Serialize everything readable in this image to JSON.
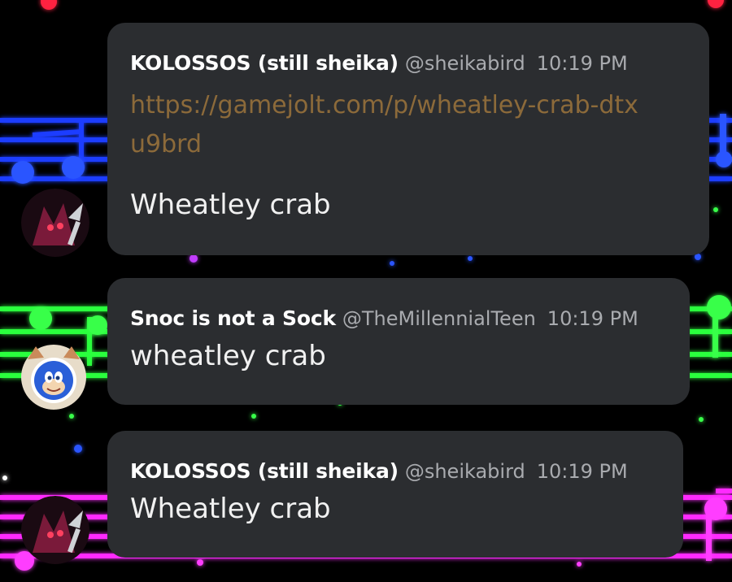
{
  "messages": [
    {
      "author": "KOLOSSOS (still sheika)",
      "handle": "@sheikabird",
      "time": "10:19 PM",
      "link": "https://gamejolt.com/p/wheatley-crab-dtxu9brd",
      "text": "Wheatley crab",
      "avatar_icon": "dark-creature-avatar-icon"
    },
    {
      "author": "Snoc is not a Sock",
      "handle": "@TheMillennialTeen",
      "time": "10:19 PM",
      "text": "wheatley crab",
      "avatar_icon": "blue-hedgehog-cat-hood-avatar-icon"
    },
    {
      "author": "KOLOSSOS (still sheika)",
      "handle": "@sheikabird",
      "time": "10:19 PM",
      "text": "Wheatley crab",
      "avatar_icon": "dark-creature-avatar-icon"
    }
  ],
  "colors": {
    "bubble": "#2b2d30",
    "link": "#8c6a3a",
    "staff_blue": "#1b3cff",
    "staff_green": "#2cff3c",
    "staff_magenta": "#ff2cff"
  }
}
